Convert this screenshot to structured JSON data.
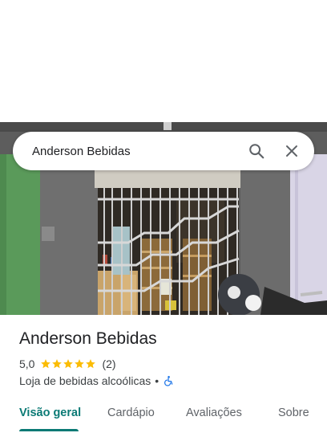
{
  "search": {
    "query": "Anderson Bebidas"
  },
  "place": {
    "name": "Anderson Bebidas",
    "rating": "5,0",
    "stars": 5,
    "review_count": "(2)",
    "category": "Loja de bebidas alcoólicas",
    "separator": "•"
  },
  "tabs": [
    {
      "label": "Visão geral",
      "active": true
    },
    {
      "label": "Cardápio"
    },
    {
      "label": "Avaliações"
    },
    {
      "label": "Sobre"
    }
  ],
  "colors": {
    "accent": "#0b7a75",
    "star": "#fbbc04",
    "text": "#202124",
    "secondary": "#3c4043",
    "accessibility": "#1a73e8"
  },
  "icons": {
    "search": "search-icon",
    "close": "close-icon",
    "accessibility": "wheelchair-icon",
    "star": "star-icon"
  }
}
